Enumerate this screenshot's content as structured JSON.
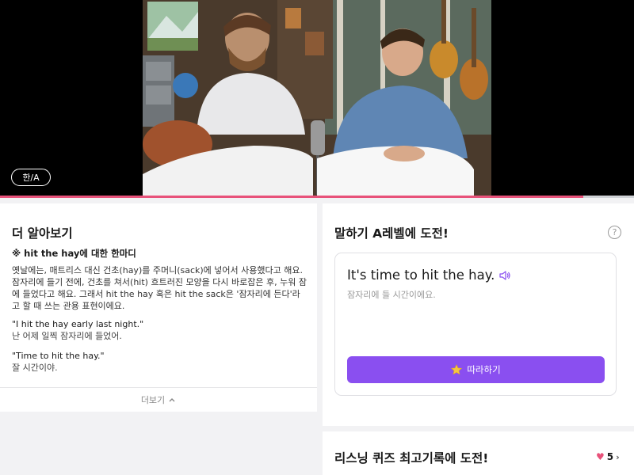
{
  "video": {
    "lang_toggle_label": "한/A",
    "progress_fraction": 0.92
  },
  "learn_more": {
    "title": "더 알아보기",
    "expression_heading": "※ hit the hay에 대한 한마디",
    "description": "옛날에는, 매트리스 대신 건초(hay)를 주머니(sack)에 넣어서 사용했다고 해요. 잠자리에 들기 전에, 건초를 쳐서(hit) 흐트러진 모양을 다시 바로잡은 후, 누워 잠에 들었다고 해요. 그래서  hit the hay 혹은 hit the sack은 '잠자리에 든다'라고 할 때 쓰는 관용 표현이에요.",
    "examples": [
      {
        "en": "\"I hit the hay early last night.\"",
        "ko": "난 어제 일찍 잠자리에 들었어."
      },
      {
        "en": "\"Time to hit the hay.\"",
        "ko": "잘 시간이야."
      }
    ],
    "more_label": "더보기"
  },
  "speaking": {
    "title": "말하기 A레벨에 도전!",
    "sentence": "It's time to hit the hay.",
    "translation": "잠자리에 들 시간이에요.",
    "follow_label": "따라하기",
    "help_symbol": "?"
  },
  "quiz": {
    "title": "리스닝 퀴즈 최고기록에 도전!",
    "score": "5"
  },
  "colors": {
    "accent_purple": "#8a4ff0",
    "progress_pink": "#e8527a"
  },
  "icons": [
    "speaker-icon",
    "star-icon",
    "heart-icon",
    "chevron-up-icon",
    "chevron-right-icon",
    "help-icon"
  ]
}
